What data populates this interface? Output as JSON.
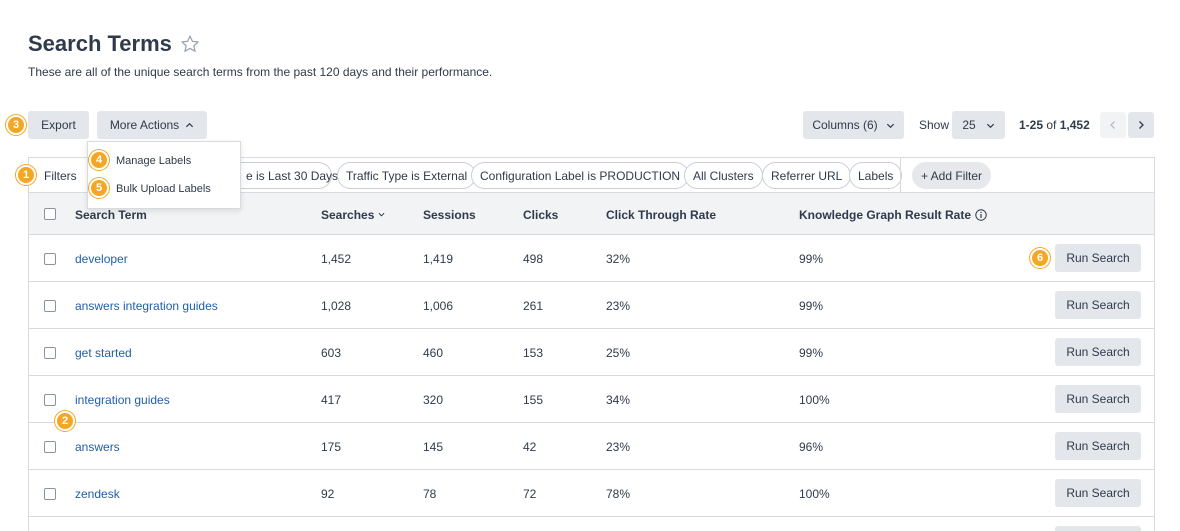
{
  "page": {
    "title": "Search Terms",
    "subtitle": "These are all of the unique search terms from the past 120 days and their performance."
  },
  "toolbar": {
    "export_label": "Export",
    "more_actions_label": "More Actions",
    "columns_label": "Columns (6)",
    "show_label": "Show",
    "show_value": "25",
    "pager_range": "1-25",
    "pager_of": " of ",
    "pager_total": "1,452"
  },
  "dropdown": {
    "items": [
      "Manage Labels",
      "Bulk Upload Labels"
    ]
  },
  "filters": {
    "label": "Filters",
    "chips": [
      "e is Last 30 Days",
      "Traffic Type is External",
      "Configuration Label is PRODUCTION",
      "All Clusters",
      "Referrer URL",
      "Labels"
    ],
    "add_label": "+ Add Filter"
  },
  "table": {
    "headers": [
      "Search Term",
      "Searches",
      "Sessions",
      "Clicks",
      "Click Through Rate",
      "Knowledge Graph Result Rate"
    ],
    "rows": [
      {
        "term": "developer",
        "searches": "1,452",
        "sessions": "1,419",
        "clicks": "498",
        "ctr": "32%",
        "kg": "99%",
        "action": "Run Search"
      },
      {
        "term": "answers integration guides",
        "searches": "1,028",
        "sessions": "1,006",
        "clicks": "261",
        "ctr": "23%",
        "kg": "99%",
        "action": "Run Search"
      },
      {
        "term": "get started",
        "searches": "603",
        "sessions": "460",
        "clicks": "153",
        "ctr": "25%",
        "kg": "99%",
        "action": "Run Search"
      },
      {
        "term": "integration guides",
        "searches": "417",
        "sessions": "320",
        "clicks": "155",
        "ctr": "34%",
        "kg": "100%",
        "action": "Run Search"
      },
      {
        "term": "answers",
        "searches": "175",
        "sessions": "145",
        "clicks": "42",
        "ctr": "23%",
        "kg": "96%",
        "action": "Run Search"
      },
      {
        "term": "zendesk",
        "searches": "92",
        "sessions": "78",
        "clicks": "72",
        "ctr": "78%",
        "kg": "100%",
        "action": "Run Search"
      }
    ]
  },
  "badges": [
    "1",
    "2",
    "3",
    "4",
    "5",
    "6"
  ],
  "colors": {
    "accent_badge": "#f5a623",
    "link": "#1f5fa8",
    "button_bg": "#e3e6ea",
    "text": "#2f3a4a"
  },
  "icons": [
    "star-icon",
    "chevron-up-icon",
    "chevron-down-icon",
    "chevron-left-icon",
    "chevron-right-icon",
    "info-icon",
    "sort-down-icon"
  ]
}
